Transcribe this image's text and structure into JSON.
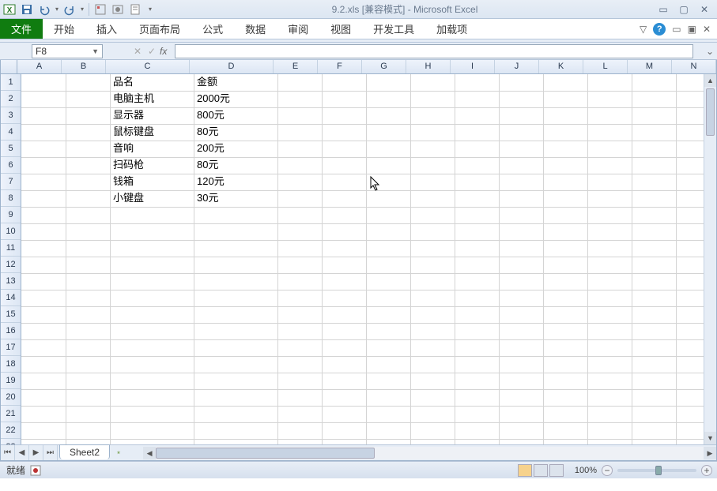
{
  "title": "9.2.xls [兼容模式] - Microsoft Excel",
  "ribbon": {
    "file": "文件",
    "tabs": [
      "开始",
      "插入",
      "页面布局",
      "公式",
      "数据",
      "审阅",
      "视图",
      "开发工具",
      "加载项"
    ]
  },
  "namebox": "F8",
  "formula": "",
  "columns": [
    "A",
    "B",
    "C",
    "D",
    "E",
    "F",
    "G",
    "H",
    "I",
    "J",
    "K",
    "L",
    "M",
    "N"
  ],
  "wide_cols": [
    "C",
    "D"
  ],
  "row_count": 23,
  "cells": [
    {
      "r": 1,
      "c": "C",
      "v": "品名"
    },
    {
      "r": 1,
      "c": "D",
      "v": "金额"
    },
    {
      "r": 2,
      "c": "C",
      "v": "电脑主机"
    },
    {
      "r": 2,
      "c": "D",
      "v": "2000元"
    },
    {
      "r": 3,
      "c": "C",
      "v": "显示器"
    },
    {
      "r": 3,
      "c": "D",
      "v": "800元"
    },
    {
      "r": 4,
      "c": "C",
      "v": "鼠标键盘"
    },
    {
      "r": 4,
      "c": "D",
      "v": "80元"
    },
    {
      "r": 5,
      "c": "C",
      "v": "音响"
    },
    {
      "r": 5,
      "c": "D",
      "v": "200元"
    },
    {
      "r": 6,
      "c": "C",
      "v": "扫码枪"
    },
    {
      "r": 6,
      "c": "D",
      "v": "80元"
    },
    {
      "r": 7,
      "c": "C",
      "v": "钱箱"
    },
    {
      "r": 7,
      "c": "D",
      "v": "120元"
    },
    {
      "r": 8,
      "c": "C",
      "v": "小键盘"
    },
    {
      "r": 8,
      "c": "D",
      "v": "30元"
    }
  ],
  "sheet_tab": "Sheet2",
  "status": {
    "ready": "就绪",
    "zoom": "100%"
  },
  "chart_data": {
    "type": "table",
    "title": "",
    "columns": [
      "品名",
      "金额"
    ],
    "rows": [
      [
        "电脑主机",
        "2000元"
      ],
      [
        "显示器",
        "800元"
      ],
      [
        "鼠标键盘",
        "80元"
      ],
      [
        "音响",
        "200元"
      ],
      [
        "扫码枪",
        "80元"
      ],
      [
        "钱箱",
        "120元"
      ],
      [
        "小键盘",
        "30元"
      ]
    ]
  }
}
